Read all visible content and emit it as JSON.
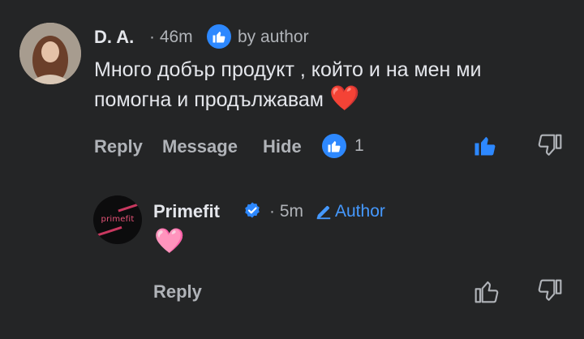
{
  "comment": {
    "author": "D. A.",
    "time": "· 46m",
    "author_badge_text": "by author",
    "text_line1": "Много добър продукт , който и на мен ми",
    "text_line2": "помогна и продължавам",
    "emoji": "❤️",
    "actions": {
      "reply": "Reply",
      "message": "Message",
      "hide": "Hide"
    },
    "reaction_count": "1"
  },
  "reply": {
    "author": "Primefit",
    "time": "· 5m",
    "author_tag": "Author",
    "avatar_text": "primefit",
    "text": "🩷",
    "actions": {
      "reply": "Reply"
    }
  },
  "colors": {
    "background": "#242526",
    "accent": "#2d88ff",
    "secondary_text": "#b0b3b8",
    "heart": "#e8293b",
    "pink_heart": "#f06ac0"
  }
}
